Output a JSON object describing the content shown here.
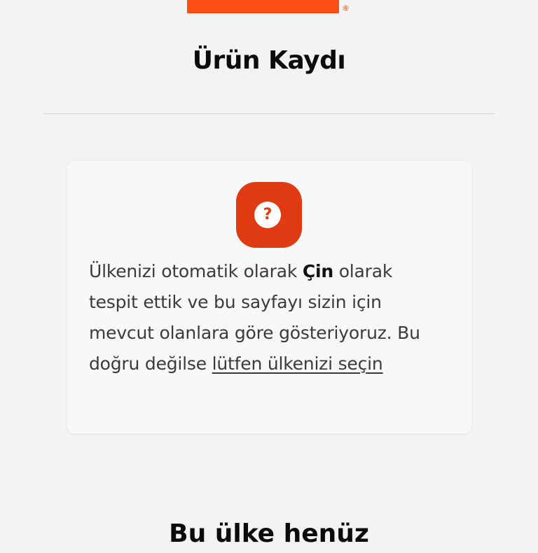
{
  "logo": {
    "brand_color": "#fd4f13",
    "registered_mark": "®"
  },
  "header": {
    "title": "Ürün Kaydı"
  },
  "notice": {
    "icon": "question-icon",
    "icon_glyph": "?",
    "accent_color": "#e03a12",
    "text_before": "Ülkenizi otomatik olarak ",
    "country": "Çin",
    "text_middle": " olarak tespit ettik ve bu sayfayı sizin için mevcut olanlara göre gösteriyoruz. Bu doğru değilse ",
    "link_label": "lütfen ülkenizi seçin"
  },
  "next_section": {
    "title": "Bu ülke henüz"
  }
}
